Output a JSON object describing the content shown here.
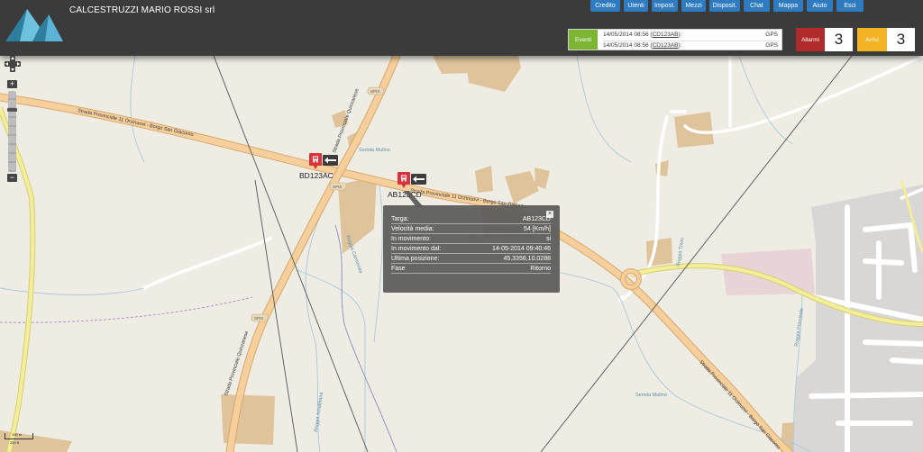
{
  "company": "CALCESTRUZZI MARIO ROSSI srl",
  "nav": [
    {
      "label": "Credito"
    },
    {
      "label": "Utenti"
    },
    {
      "label": "Impost."
    },
    {
      "label": "Mezzi"
    },
    {
      "label": "Disposit."
    },
    {
      "label": "Chat"
    },
    {
      "label": "Mappa"
    },
    {
      "label": "Aiuto"
    },
    {
      "label": "Esci"
    }
  ],
  "events": {
    "label": "Eventi",
    "rows": [
      {
        "date": "14/05/2014 08:56",
        "plate": "CD123AB",
        "type": "GPS"
      },
      {
        "date": "14/05/2014 08:56",
        "plate": "CD123AB",
        "type": "GPS"
      }
    ]
  },
  "alarms": {
    "label": "Allarmi",
    "count": "3"
  },
  "arrivals": {
    "label": "Arrivi",
    "count": "3"
  },
  "zoom": {
    "in": "+",
    "out": "−"
  },
  "scale": {
    "top": "100 m",
    "bottom": "200 ft"
  },
  "map": {
    "road_labels": {
      "sp11_west": "Strada Provinciale 11 Orzinuovi - Borgo San Giacomo",
      "sp11_east": "Strada Provinciale 11 Orzinuovi - Borgo San Giacomo",
      "sp11_south": "Strada Provinciale 11 Orzinuovi - Borgo San Giacomo",
      "sp_ovest": "Strada Provinciale Quinzanese",
      "sp_sud": "Strada Provinciale Quinzanese",
      "spix_1": "SPIX",
      "spix_2": "SPIX",
      "spix_3": "SPIX",
      "serioia_1": "Seriola Mulino",
      "serioia_2": "Seriola Mulino",
      "roggia_1": "Roggia Carminata",
      "roggia_2": "Roggia Trivio",
      "roggia_3": "Roggia Principale",
      "roggia_4": "Roggia Amalfitana"
    }
  },
  "vehicles": [
    {
      "plate": "BD123AC"
    },
    {
      "plate": "AB123CD"
    }
  ],
  "popup": {
    "close": "×",
    "rows": [
      {
        "label": "Targa:",
        "value": "AB123CD"
      },
      {
        "label": "Velocità media:",
        "value": "54 [Km/h]"
      },
      {
        "label": "In movimento:",
        "value": "si"
      },
      {
        "label": "In movimento dal:",
        "value": "14-05-2014 09:40:46"
      },
      {
        "label": "Ultima posizione:",
        "value": "45.3356,10.0288"
      },
      {
        "label": "Fase",
        "value": "Ritorno"
      }
    ]
  },
  "colors": {
    "header": "#3b3b3b",
    "nav_button": "#2f7bc2",
    "events": "#7cb531",
    "alarms": "#b12a2a",
    "arrivals": "#f4b324",
    "vehicle_marker": "#d8343d"
  }
}
